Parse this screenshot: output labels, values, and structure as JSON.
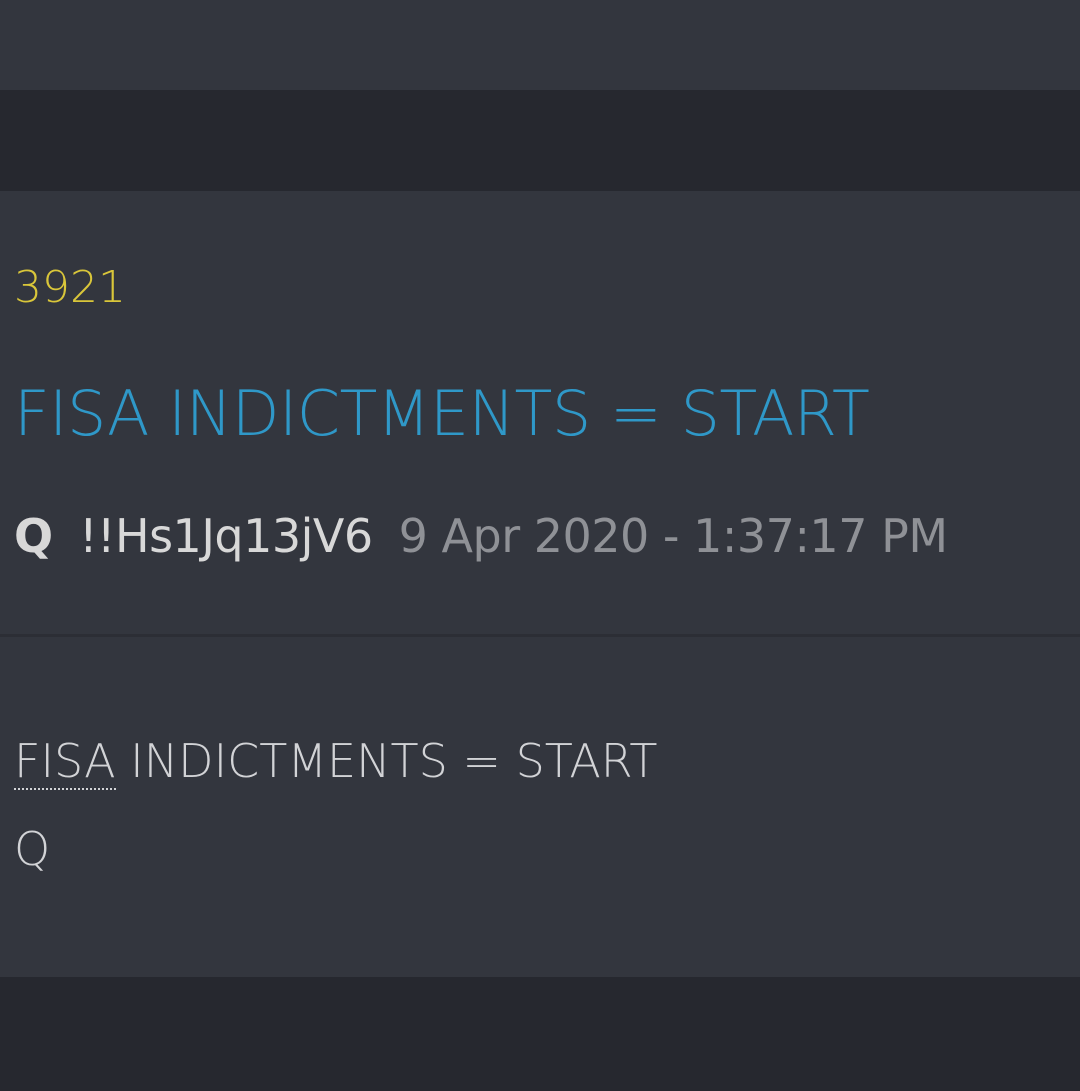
{
  "post": {
    "number": "3921",
    "title": "FISA INDICTMENTS = START",
    "author": "Q",
    "tripcode": "!!Hs1Jq13jV6",
    "timestamp": "9 Apr 2020 - 1:37:17 PM",
    "body": {
      "abbr": "FISA",
      "line1_rest": " INDICTMENTS = START",
      "line2": "Q"
    }
  },
  "colors": {
    "background": "#33363e",
    "dark_band": "#26282f",
    "number": "#d9c63a",
    "title": "#2f98c8",
    "author": "#d8d8d8",
    "date": "#8f9196",
    "body_text": "#d2d3d6"
  }
}
